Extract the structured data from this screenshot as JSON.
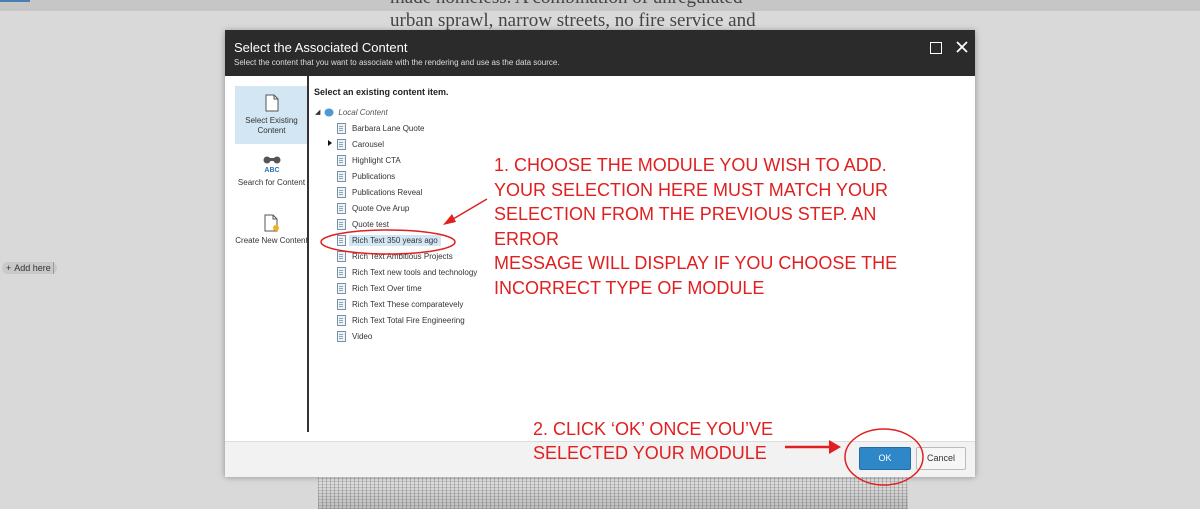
{
  "background": {
    "article_text_line1": "made homeless. A combination of unregulated",
    "article_text_line2": "urban sprawl, narrow streets, no fire service and",
    "add_here_label": "Add here"
  },
  "dialog": {
    "title": "Select the Associated Content",
    "subtitle": "Select the content that you want to associate with the rendering and use as the data source.",
    "sidebar": [
      {
        "label": "Select Existing Content",
        "icon": "document-icon",
        "active": true
      },
      {
        "label": "Search for Content",
        "icon": "binoculars-abc-icon",
        "active": false
      },
      {
        "label": "Create New Content",
        "icon": "new-document-icon",
        "active": false
      }
    ],
    "tree_heading": "Select an existing content item.",
    "tree_root": "Local Content",
    "tree_items": [
      "Barbara Lane Quote",
      "Carousel",
      "Highlight CTA",
      "Publications",
      "Publications Reveal",
      "Quote Ove Arup",
      "Quote test",
      "Rich Text 350 years ago",
      "Rich Text Ambitious Projects",
      "Rich Text new tools and technology",
      "Rich Text Over time",
      "Rich Text These comparatevely",
      "Rich Text Total Fire Engineering",
      "Video"
    ],
    "selected_item": "Rich Text 350 years ago",
    "ok_label": "OK",
    "cancel_label": "Cancel"
  },
  "annotations": {
    "step1": [
      "1. CHOOSE THE MODULE YOU WISH TO ADD.",
      "YOUR SELECTION HERE MUST MATCH YOUR",
      "SELECTION FROM THE PREVIOUS STEP. AN ERROR",
      "MESSAGE WILL DISPLAY IF YOU CHOOSE THE",
      "INCORRECT TYPE OF MODULE"
    ],
    "step2": [
      "2. CLICK ‘OK’ ONCE YOU’VE",
      "SELECTED YOUR MODULE"
    ],
    "color": "#e02020"
  }
}
